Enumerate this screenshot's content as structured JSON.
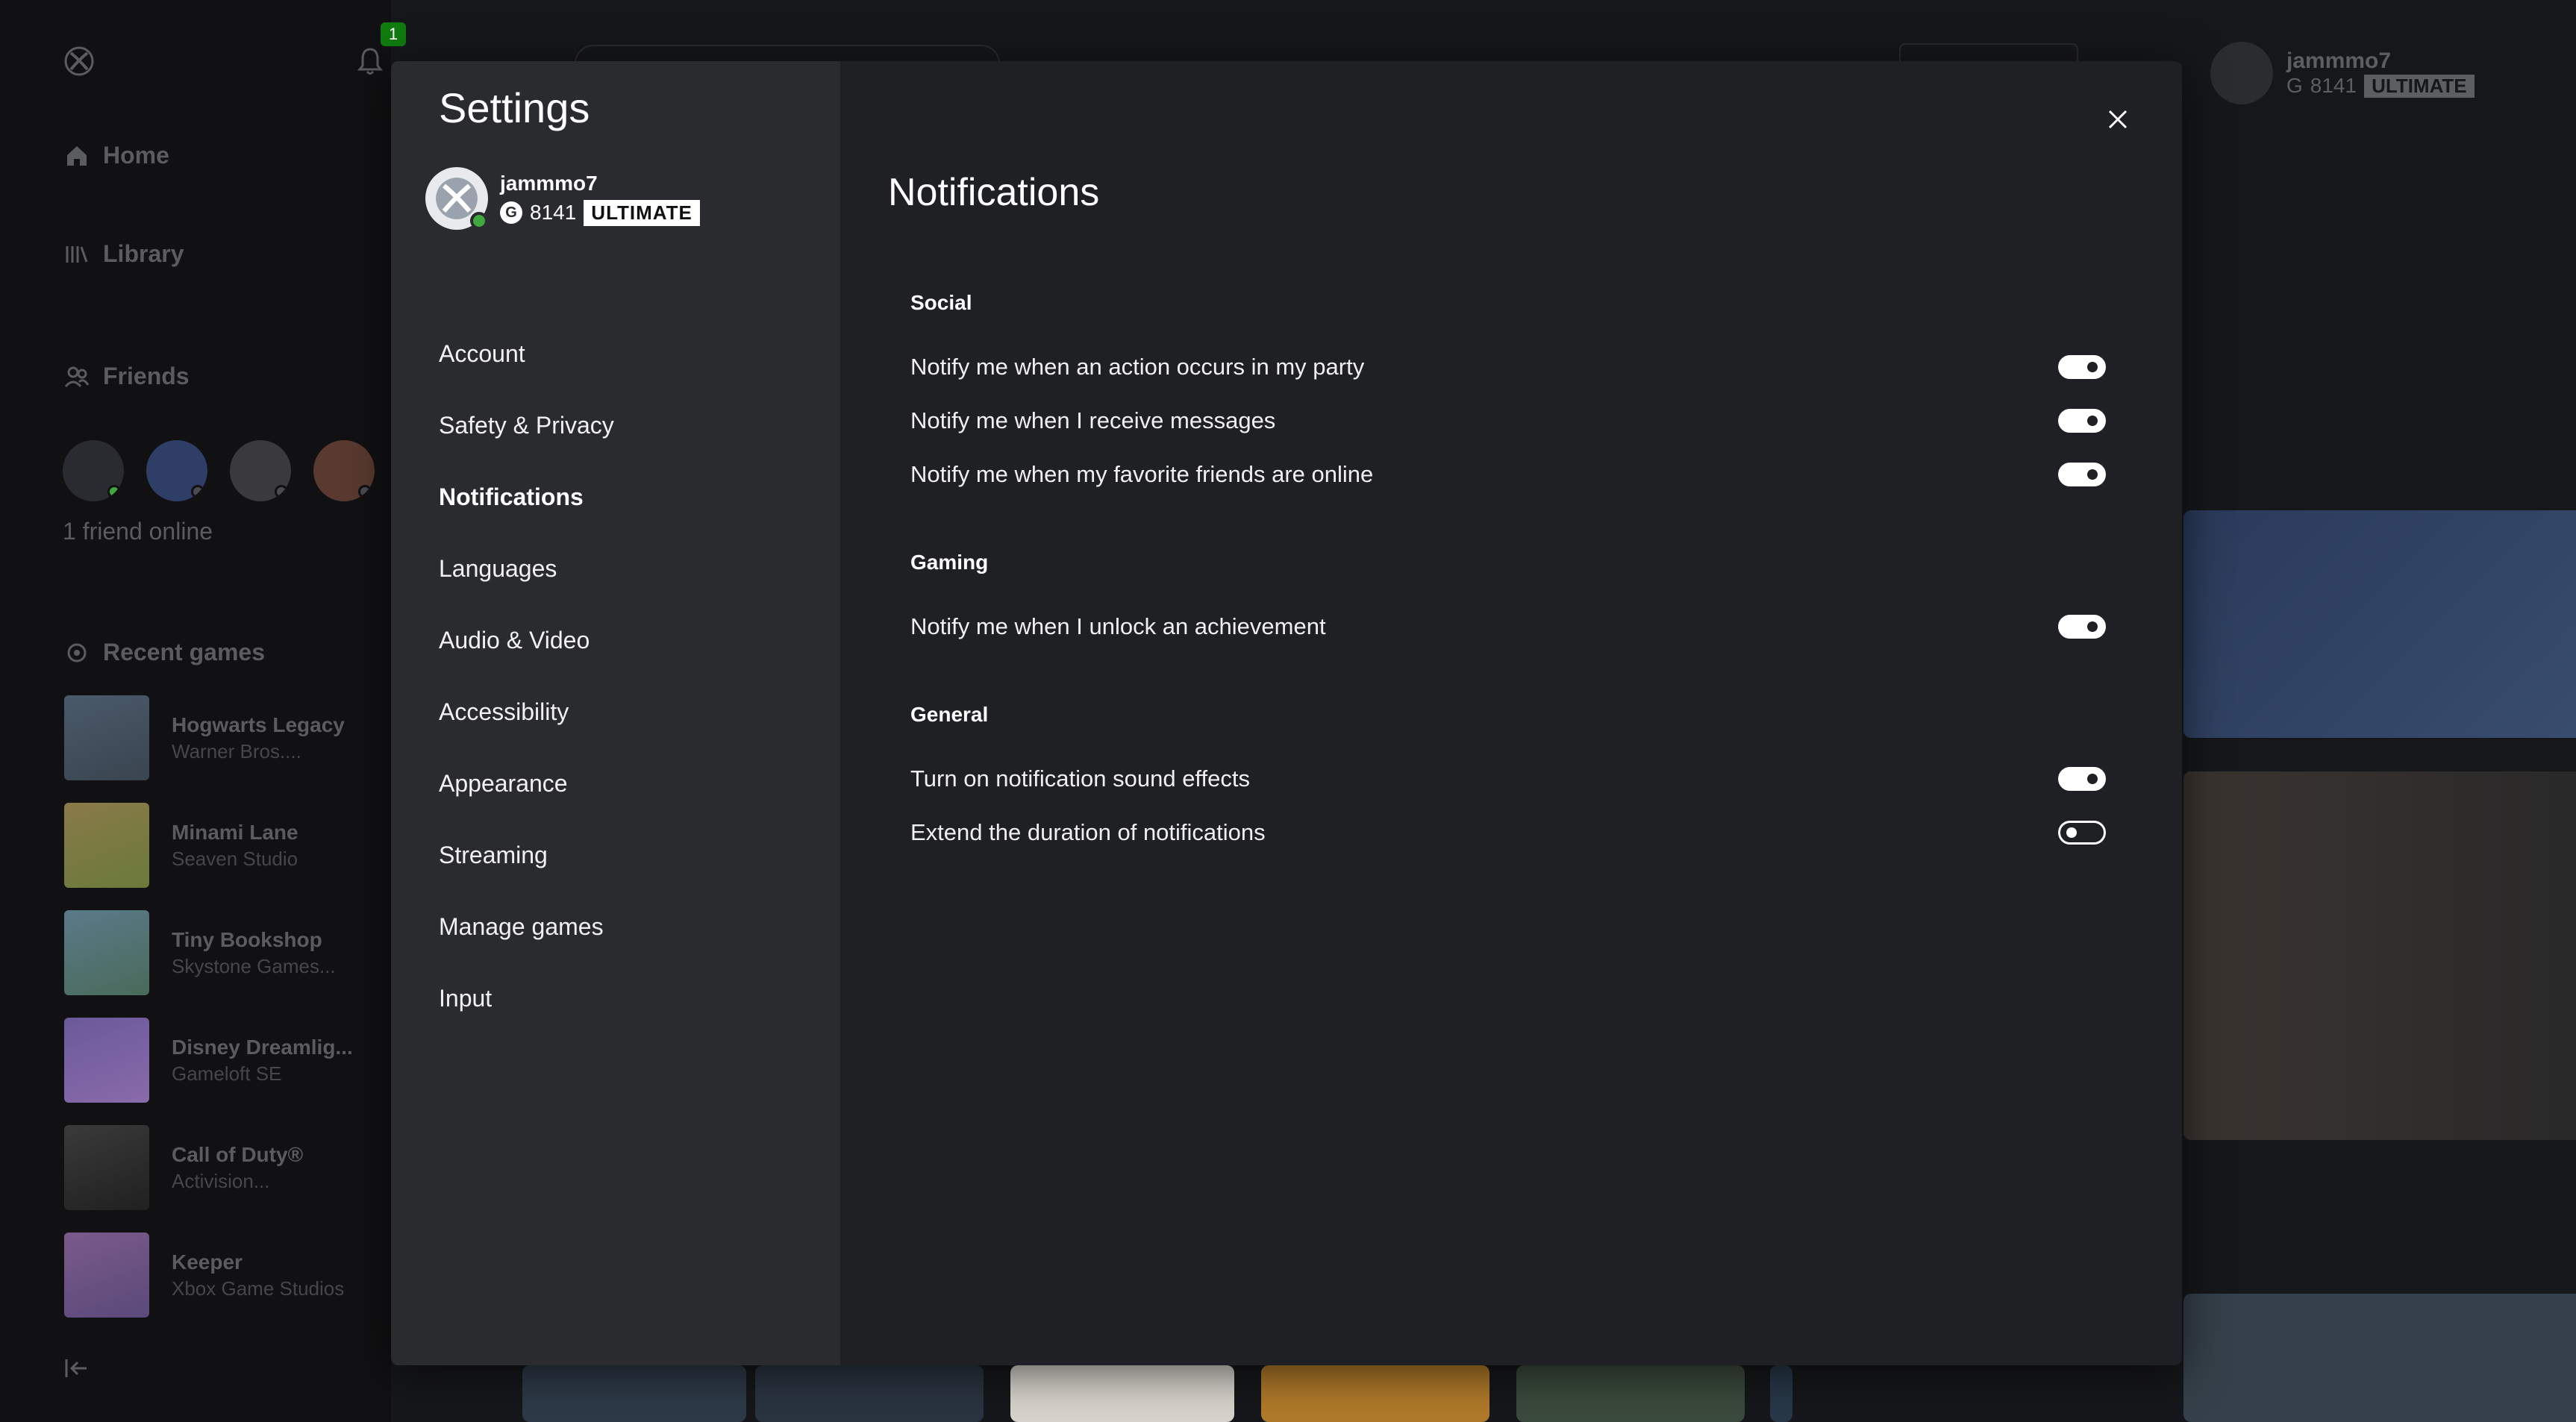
{
  "background": {
    "notification_count": "1",
    "nav": {
      "home": "Home",
      "library": "Library",
      "friends": "Friends",
      "recent_games": "Recent games"
    },
    "friends_online": "1 friend online",
    "recent_games": [
      {
        "title": "Hogwarts Legacy",
        "publisher": "Warner Bros...."
      },
      {
        "title": "Minami Lane",
        "publisher": "Seaven Studio"
      },
      {
        "title": "Tiny Bookshop",
        "publisher": "Skystone Games..."
      },
      {
        "title": "Disney Dreamlig...",
        "publisher": "Gameloft SE"
      },
      {
        "title": "Call of Duty®",
        "publisher": "Activision..."
      },
      {
        "title": "Keeper",
        "publisher": "Xbox Game Studios"
      }
    ],
    "user": {
      "gamertag": "jammmo7",
      "score": "8141",
      "tier": "ULTIMATE"
    }
  },
  "settings": {
    "title": "Settings",
    "profile": {
      "gamertag": "jammmo7",
      "score": "8141",
      "tier": "ULTIMATE"
    },
    "menu": [
      {
        "label": "Account",
        "active": false
      },
      {
        "label": "Safety & Privacy",
        "active": false
      },
      {
        "label": "Notifications",
        "active": true
      },
      {
        "label": "Languages",
        "active": false
      },
      {
        "label": "Audio & Video",
        "active": false
      },
      {
        "label": "Accessibility",
        "active": false
      },
      {
        "label": "Appearance",
        "active": false
      },
      {
        "label": "Streaming",
        "active": false
      },
      {
        "label": "Manage games",
        "active": false
      },
      {
        "label": "Input",
        "active": false
      }
    ],
    "page_title": "Notifications",
    "sections": [
      {
        "heading": "Social",
        "items": [
          {
            "label": "Notify me when an action occurs in my party",
            "on": true
          },
          {
            "label": "Notify me when I receive messages",
            "on": true
          },
          {
            "label": "Notify me when my favorite friends are online",
            "on": true
          }
        ]
      },
      {
        "heading": "Gaming",
        "items": [
          {
            "label": "Notify me when I unlock an achievement",
            "on": true
          }
        ]
      },
      {
        "heading": "General",
        "items": [
          {
            "label": "Turn on notification sound effects",
            "on": true
          },
          {
            "label": "Extend the duration of notifications",
            "on": false
          }
        ]
      }
    ]
  },
  "colors": {
    "status_online": "#3fa83f",
    "notification_badge": "#107c10",
    "modal_bg": "#1f2023",
    "nav_bg": "#2a2b2f"
  }
}
